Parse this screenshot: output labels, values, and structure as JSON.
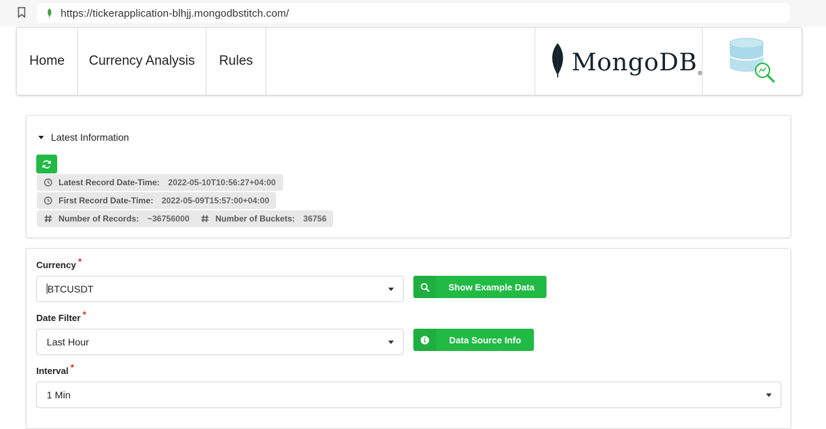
{
  "browser": {
    "url": "https://tickerapplication-blhjj.mongodbstitch.com/"
  },
  "nav": {
    "items": [
      {
        "label": "Home"
      },
      {
        "label": "Currency Analysis"
      },
      {
        "label": "Rules"
      }
    ],
    "logo": {
      "word": "MongoDB",
      "registered": "®",
      "leaf_color": "#13222b"
    }
  },
  "latest_info": {
    "title": "Latest Information",
    "latest_record": {
      "label": "Latest Record Date-Time:",
      "value": "2022-05-10T10:56:27+04:00"
    },
    "first_record": {
      "label": "First Record Date-Time:",
      "value": "2022-05-09T15:57:00+04:00"
    },
    "num_records": {
      "label": "Number of Records:",
      "value": "~36756000"
    },
    "num_buckets": {
      "label": "Number of Buckets:",
      "value": "36756"
    }
  },
  "form": {
    "currency": {
      "label": "Currency",
      "required": "*",
      "value": "BTCUSDT"
    },
    "date_filter": {
      "label": "Date Filter",
      "required": "*",
      "value": "Last Hour"
    },
    "interval": {
      "label": "Interval",
      "required": "*",
      "value": "1 Min"
    },
    "show_example_button": "Show Example Data",
    "data_source_button": "Data Source Info"
  },
  "colors": {
    "accent_green": "#21ba45",
    "required_red": "#db2828",
    "chip_bg": "#e8e8e8"
  },
  "icons": [
    "bookmark-icon",
    "leaf-icon",
    "refresh-icon",
    "clock-icon",
    "hash-icon",
    "search-icon",
    "info-icon",
    "chevron-down-icon",
    "database-search-icon"
  ]
}
